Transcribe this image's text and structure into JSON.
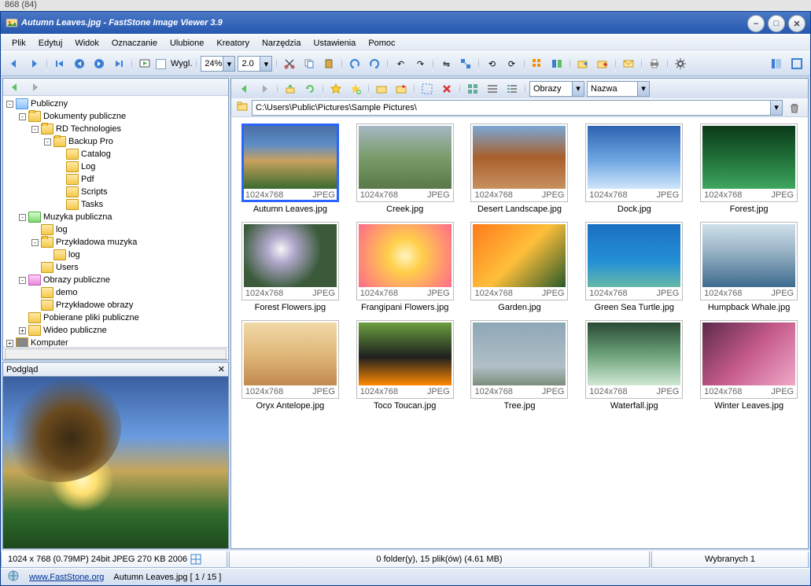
{
  "outerInfo": "868 (84)",
  "title": "Autumn Leaves.jpg  -  FastStone Image Viewer 3.9",
  "menu": [
    "Plik",
    "Edytuj",
    "Widok",
    "Oznaczanie",
    "Ulubione",
    "Kreatory",
    "Narzędzia",
    "Ustawienia",
    "Pomoc"
  ],
  "toolbar": {
    "zoomPct": "24%",
    "secondsPct": "2.0",
    "viewLabel": "Wygl."
  },
  "thumbToolbar": {
    "filterDropdown": "Obrazy",
    "sortDropdown": "Nazwa"
  },
  "path": "C:\\Users\\Public\\Pictures\\Sample Pictures\\",
  "tree": [
    {
      "indent": 0,
      "exp": "-",
      "icon": "pub",
      "label": "Publiczny"
    },
    {
      "indent": 1,
      "exp": "-",
      "icon": "open",
      "label": "Dokumenty publiczne"
    },
    {
      "indent": 2,
      "exp": "-",
      "icon": "open",
      "label": "RD Technologies"
    },
    {
      "indent": 3,
      "exp": "-",
      "icon": "open",
      "label": "Backup Pro"
    },
    {
      "indent": 4,
      "exp": "",
      "icon": "",
      "label": "Catalog"
    },
    {
      "indent": 4,
      "exp": "",
      "icon": "",
      "label": "Log"
    },
    {
      "indent": 4,
      "exp": "",
      "icon": "",
      "label": "Pdf"
    },
    {
      "indent": 4,
      "exp": "",
      "icon": "",
      "label": "Scripts"
    },
    {
      "indent": 4,
      "exp": "",
      "icon": "",
      "label": "Tasks"
    },
    {
      "indent": 1,
      "exp": "-",
      "icon": "mus",
      "label": "Muzyka publiczna"
    },
    {
      "indent": 2,
      "exp": "",
      "icon": "",
      "label": "log"
    },
    {
      "indent": 2,
      "exp": "-",
      "icon": "open",
      "label": "Przykładowa muzyka"
    },
    {
      "indent": 3,
      "exp": "",
      "icon": "",
      "label": "log"
    },
    {
      "indent": 2,
      "exp": "",
      "icon": "",
      "label": "Users"
    },
    {
      "indent": 1,
      "exp": "-",
      "icon": "img",
      "label": "Obrazy publiczne"
    },
    {
      "indent": 2,
      "exp": "",
      "icon": "",
      "label": "demo"
    },
    {
      "indent": 2,
      "exp": "",
      "icon": "",
      "label": "Przykładowe obrazy"
    },
    {
      "indent": 1,
      "exp": "",
      "icon": "",
      "label": "Pobierane pliki publiczne"
    },
    {
      "indent": 1,
      "exp": "+",
      "icon": "",
      "label": "Wideo publiczne"
    },
    {
      "indent": 0,
      "exp": "+",
      "icon": "dot",
      "label": "Komputer"
    }
  ],
  "previewLabel": "Podgląd",
  "thumbnails": [
    {
      "name": "Autumn Leaves.jpg",
      "dim": "1024x768",
      "fmt": "JPEG",
      "selected": true,
      "grad": "linear-gradient(180deg,#4a6fa5 0%,#5d8cc7 30%,#c9a15f 55%,#3a6b2e 100%)"
    },
    {
      "name": "Creek.jpg",
      "dim": "1024x768",
      "fmt": "JPEG",
      "grad": "linear-gradient(180deg,#a5b7c3 0%,#7a9c6a 50%,#5a7848 100%)"
    },
    {
      "name": "Desert Landscape.jpg",
      "dim": "1024x768",
      "fmt": "JPEG",
      "grad": "linear-gradient(180deg,#7aa7d6 0%,#a8602b 50%,#c89060 100%)"
    },
    {
      "name": "Dock.jpg",
      "dim": "1024x768",
      "fmt": "JPEG",
      "grad": "linear-gradient(180deg,#2d63b0 0%,#6fa6e2 55%,#cfe6fb 100%)"
    },
    {
      "name": "Forest.jpg",
      "dim": "1024x768",
      "fmt": "JPEG",
      "grad": "linear-gradient(180deg,#0b3a1a 0%,#1f6e38 50%,#3fa75f 100%)"
    },
    {
      "name": "Forest Flowers.jpg",
      "dim": "1024x768",
      "fmt": "JPEG",
      "grad": "radial-gradient(circle at 40% 40%,#f6f6f6 0%,#b2a8cc 20%,#3a5a3a 60%)"
    },
    {
      "name": "Frangipani Flowers.jpg",
      "dim": "1024x768",
      "fmt": "JPEG",
      "grad": "radial-gradient(circle at 50% 50%,#fff4c0 0%,#ffcf4a 30%,#ff6a8b 100%)"
    },
    {
      "name": "Garden.jpg",
      "dim": "1024x768",
      "fmt": "JPEG",
      "grad": "linear-gradient(135deg,#ff7a1c 0%,#ffbf3a 50%,#2a5a2a 100%)"
    },
    {
      "name": "Green Sea Turtle.jpg",
      "dim": "1024x768",
      "fmt": "JPEG",
      "grad": "linear-gradient(180deg,#1a6fc0 0%,#2590d6 60%,#66b9a8 100%)"
    },
    {
      "name": "Humpback Whale.jpg",
      "dim": "1024x768",
      "fmt": "JPEG",
      "grad": "linear-gradient(180deg,#cfe0eb 0%,#9db6c7 40%,#3e6b8e 100%)"
    },
    {
      "name": "Oryx Antelope.jpg",
      "dim": "1024x768",
      "fmt": "JPEG",
      "grad": "linear-gradient(180deg,#f1d8a8 0%,#e0b87a 50%,#c18a4e 100%)"
    },
    {
      "name": "Toco Toucan.jpg",
      "dim": "1024x768",
      "fmt": "JPEG",
      "grad": "linear-gradient(180deg,#6b9f3e 0%,#1f1f1f 55%,#ff8a00 100%)"
    },
    {
      "name": "Tree.jpg",
      "dim": "1024x768",
      "fmt": "JPEG",
      "grad": "linear-gradient(180deg,#8ea7b6 0%,#b1bfc7 70%,#7a8e7b 100%)"
    },
    {
      "name": "Waterfall.jpg",
      "dim": "1024x768",
      "fmt": "JPEG",
      "grad": "linear-gradient(180deg,#2a4a34 0%,#6aa078 50%,#cfe8d4 100%)"
    },
    {
      "name": "Winter Leaves.jpg",
      "dim": "1024x768",
      "fmt": "JPEG",
      "grad": "linear-gradient(135deg,#5c2a4a 0%,#c45a8a 50%,#f0a8c8 100%)"
    }
  ],
  "status": {
    "imgInfo": "1024 x 768 (0.79MP)   24bit JPEG   270 KB   2006",
    "folderInfo": "0 folder(y), 15 plik(ów) (4.61 MB)",
    "selectionInfo": "Wybranych 1"
  },
  "footer": {
    "siteLink": "www.FastStone.org",
    "fileCounter": "Autumn Leaves.jpg [ 1 / 15 ]"
  }
}
